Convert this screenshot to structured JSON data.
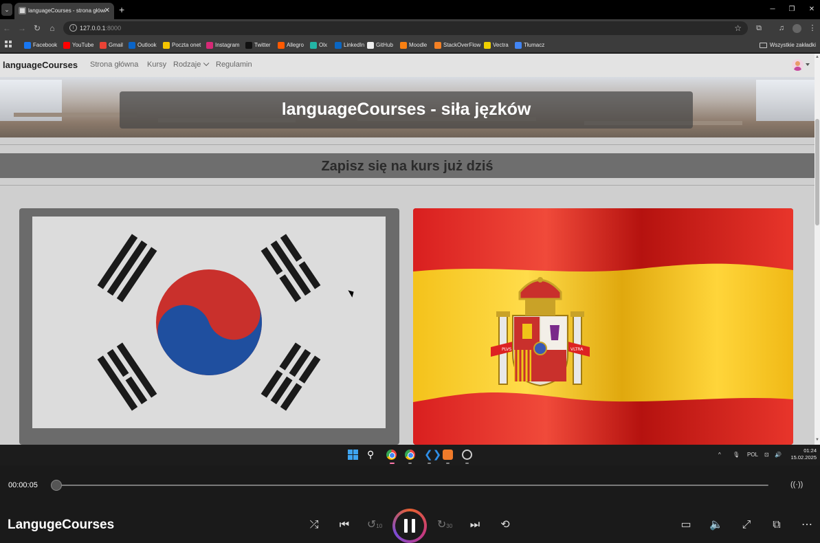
{
  "browser": {
    "tab_title": "languageCourses - strona główna",
    "url_host": "127.0.0.1",
    "url_port": ":8000",
    "bookmarks": [
      {
        "label": "Facebook",
        "color": "#1877f2"
      },
      {
        "label": "YouTube",
        "color": "#ff0000"
      },
      {
        "label": "Gmail",
        "color": "#ea4335"
      },
      {
        "label": "Outlook",
        "color": "#0a64c8"
      },
      {
        "label": "Poczta onet",
        "color": "#f5c400"
      },
      {
        "label": "Instagram",
        "color": "#d62976"
      },
      {
        "label": "Twitter",
        "color": "#111111"
      },
      {
        "label": "Allegro",
        "color": "#ff5a00"
      },
      {
        "label": "Olx",
        "color": "#23b5a6"
      },
      {
        "label": "LinkedIn",
        "color": "#0a66c2"
      },
      {
        "label": "GitHub",
        "color": "#eeeeee"
      },
      {
        "label": "Moodle",
        "color": "#f98012"
      },
      {
        "label": "StackOverFlow",
        "color": "#f48024"
      },
      {
        "label": "Vectra",
        "color": "#f0d000"
      },
      {
        "label": "Tłumacz",
        "color": "#4285f4"
      }
    ],
    "all_bookmarks_label": "Wszystkie zakładki"
  },
  "site": {
    "brand": "languageCourses",
    "nav": [
      {
        "label": "Strona główna"
      },
      {
        "label": "Kursy"
      },
      {
        "label": "Rodzaje"
      },
      {
        "label": "Regulamin"
      }
    ],
    "hero_title": "languageCourses - siła jęzków",
    "cta_heading": "Zapisz się na kurs już dziś",
    "cards": [
      {
        "name": "korea-flag"
      },
      {
        "name": "spain-flag"
      }
    ],
    "spain_coat_text": {
      "left": "PLVS",
      "right": "VLTRA"
    }
  },
  "taskbar": {
    "language": "POL",
    "time": "01:24",
    "date": "15.02.2025"
  },
  "player": {
    "current_time": "00:00:05",
    "progress": 0.0,
    "title": "LangugeCourses",
    "skip_back_seconds": "10",
    "skip_forward_seconds": "30",
    "accent_colors": [
      "#e7612f",
      "#c5397e",
      "#7b4bd6"
    ]
  }
}
